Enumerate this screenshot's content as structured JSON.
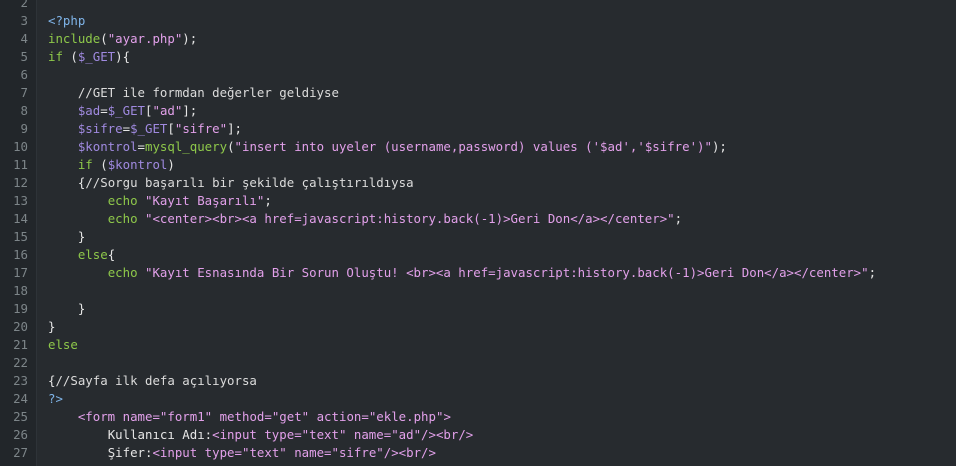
{
  "editor": {
    "language": "php",
    "lines": [
      {
        "n": "2",
        "indent": "",
        "tokens": []
      },
      {
        "n": "3",
        "indent": "",
        "tokens": [
          {
            "t": "<?php",
            "c": "php"
          }
        ]
      },
      {
        "n": "4",
        "indent": "",
        "tokens": [
          {
            "t": "include",
            "c": "fn"
          },
          {
            "t": "(",
            "c": "pl"
          },
          {
            "t": "\"ayar.php\"",
            "c": "str"
          },
          {
            "t": ");",
            "c": "pl"
          }
        ]
      },
      {
        "n": "5",
        "indent": "",
        "tokens": [
          {
            "t": "if",
            "c": "fn"
          },
          {
            "t": " (",
            "c": "pl"
          },
          {
            "t": "$_GET",
            "c": "var"
          },
          {
            "t": "){",
            "c": "pl"
          }
        ]
      },
      {
        "n": "6",
        "indent": "",
        "tokens": []
      },
      {
        "n": "7",
        "indent": "    ",
        "tokens": [
          {
            "t": "//GET ile formdan değerler geldiyse",
            "c": "cmt"
          }
        ]
      },
      {
        "n": "8",
        "indent": "    ",
        "tokens": [
          {
            "t": "$ad",
            "c": "var"
          },
          {
            "t": "=",
            "c": "pl"
          },
          {
            "t": "$_GET",
            "c": "var"
          },
          {
            "t": "[",
            "c": "pl"
          },
          {
            "t": "\"ad\"",
            "c": "str"
          },
          {
            "t": "];",
            "c": "pl"
          }
        ]
      },
      {
        "n": "9",
        "indent": "    ",
        "tokens": [
          {
            "t": "$sifre",
            "c": "var"
          },
          {
            "t": "=",
            "c": "pl"
          },
          {
            "t": "$_GET",
            "c": "var"
          },
          {
            "t": "[",
            "c": "pl"
          },
          {
            "t": "\"sifre\"",
            "c": "str"
          },
          {
            "t": "];",
            "c": "pl"
          }
        ]
      },
      {
        "n": "10",
        "indent": "    ",
        "tokens": [
          {
            "t": "$kontrol",
            "c": "var"
          },
          {
            "t": "=",
            "c": "pl"
          },
          {
            "t": "mysql_query",
            "c": "fn"
          },
          {
            "t": "(",
            "c": "pl"
          },
          {
            "t": "\"insert into uyeler (username,password) values ('$ad','$sifre')\"",
            "c": "str"
          },
          {
            "t": ");",
            "c": "pl"
          }
        ]
      },
      {
        "n": "11",
        "indent": "    ",
        "tokens": [
          {
            "t": "if",
            "c": "fn"
          },
          {
            "t": " (",
            "c": "pl"
          },
          {
            "t": "$kontrol",
            "c": "var"
          },
          {
            "t": ")",
            "c": "pl"
          }
        ]
      },
      {
        "n": "12",
        "indent": "    ",
        "tokens": [
          {
            "t": "{",
            "c": "pl"
          },
          {
            "t": "//Sorgu başarılı bir şekilde çalıştırıldıysa",
            "c": "cmt"
          }
        ]
      },
      {
        "n": "13",
        "indent": "        ",
        "tokens": [
          {
            "t": "echo",
            "c": "fn"
          },
          {
            "t": " ",
            "c": "pl"
          },
          {
            "t": "\"Kayıt Başarılı\"",
            "c": "str"
          },
          {
            "t": ";",
            "c": "pl"
          }
        ]
      },
      {
        "n": "14",
        "indent": "        ",
        "tokens": [
          {
            "t": "echo",
            "c": "fn"
          },
          {
            "t": " ",
            "c": "pl"
          },
          {
            "t": "\"<center><br><a href=javascript:history.back(-1)>Geri Don</a></center>\"",
            "c": "str"
          },
          {
            "t": ";",
            "c": "pl"
          }
        ]
      },
      {
        "n": "15",
        "indent": "    ",
        "tokens": [
          {
            "t": "}",
            "c": "pl"
          }
        ]
      },
      {
        "n": "16",
        "indent": "    ",
        "tokens": [
          {
            "t": "else",
            "c": "fn"
          },
          {
            "t": "{",
            "c": "pl"
          }
        ]
      },
      {
        "n": "17",
        "indent": "        ",
        "tokens": [
          {
            "t": "echo",
            "c": "fn"
          },
          {
            "t": " ",
            "c": "pl"
          },
          {
            "t": "\"Kayıt Esnasında Bir Sorun Oluştu! <br><a href=javascript:history.back(-1)>Geri Don</a></center>\"",
            "c": "str"
          },
          {
            "t": ";",
            "c": "pl"
          }
        ]
      },
      {
        "n": "18",
        "indent": "",
        "tokens": []
      },
      {
        "n": "19",
        "indent": "    ",
        "tokens": [
          {
            "t": "}",
            "c": "pl"
          }
        ]
      },
      {
        "n": "20",
        "indent": "",
        "tokens": [
          {
            "t": "}",
            "c": "pl"
          }
        ]
      },
      {
        "n": "21",
        "indent": "",
        "tokens": [
          {
            "t": "else",
            "c": "fn"
          }
        ]
      },
      {
        "n": "22",
        "indent": "",
        "tokens": []
      },
      {
        "n": "23",
        "indent": "",
        "tokens": [
          {
            "t": "{",
            "c": "pl"
          },
          {
            "t": "//Sayfa ilk defa açılıyorsa",
            "c": "cmt"
          }
        ]
      },
      {
        "n": "24",
        "indent": "",
        "tokens": [
          {
            "t": "?>",
            "c": "php"
          }
        ]
      },
      {
        "n": "25",
        "indent": "    ",
        "tokens": [
          {
            "t": "<form",
            "c": "tag"
          },
          {
            "t": " name=",
            "c": "tag"
          },
          {
            "t": "\"form1\"",
            "c": "str"
          },
          {
            "t": " method=",
            "c": "tag"
          },
          {
            "t": "\"get\"",
            "c": "str"
          },
          {
            "t": " action=",
            "c": "tag"
          },
          {
            "t": "\"ekle.php\"",
            "c": "str"
          },
          {
            "t": ">",
            "c": "tag"
          }
        ]
      },
      {
        "n": "26",
        "indent": "        ",
        "tokens": [
          {
            "t": "Kullanıcı Adı:",
            "c": "pl"
          },
          {
            "t": "<input",
            "c": "tag"
          },
          {
            "t": " type=",
            "c": "tag"
          },
          {
            "t": "\"text\"",
            "c": "str"
          },
          {
            "t": " name=",
            "c": "tag"
          },
          {
            "t": "\"ad\"",
            "c": "str"
          },
          {
            "t": "/><br/>",
            "c": "tag"
          }
        ]
      },
      {
        "n": "27",
        "indent": "        ",
        "tokens": [
          {
            "t": "Şifer:",
            "c": "pl"
          },
          {
            "t": "<input",
            "c": "tag"
          },
          {
            "t": " type=",
            "c": "tag"
          },
          {
            "t": "\"text\"",
            "c": "str"
          },
          {
            "t": " name=",
            "c": "tag"
          },
          {
            "t": "\"sifre\"",
            "c": "str"
          },
          {
            "t": "/><br/>",
            "c": "tag"
          }
        ]
      }
    ]
  }
}
